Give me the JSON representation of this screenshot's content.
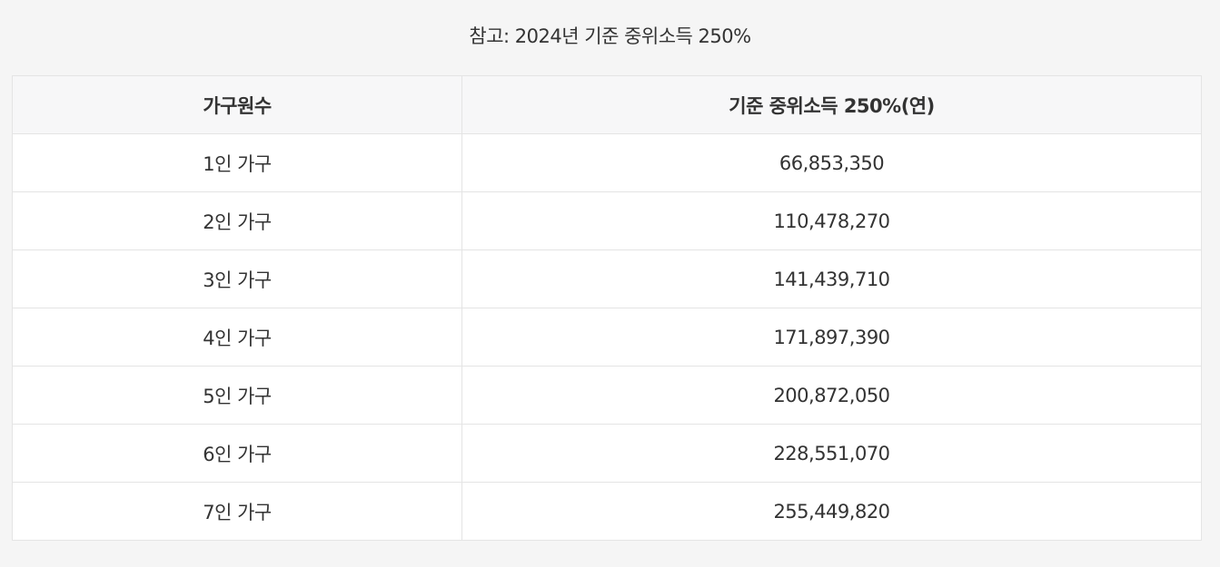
{
  "caption": "참고: 2024년 기준 중위소득 250%",
  "table": {
    "headers": [
      "가구원수",
      "기준 중위소득 250%(연)"
    ],
    "rows": [
      [
        "1인 가구",
        "66,853,350"
      ],
      [
        "2인 가구",
        "110,478,270"
      ],
      [
        "3인 가구",
        "141,439,710"
      ],
      [
        "4인 가구",
        "171,897,390"
      ],
      [
        "5인 가구",
        "200,872,050"
      ],
      [
        "6인 가구",
        "228,551,070"
      ],
      [
        "7인 가구",
        "255,449,820"
      ]
    ]
  }
}
